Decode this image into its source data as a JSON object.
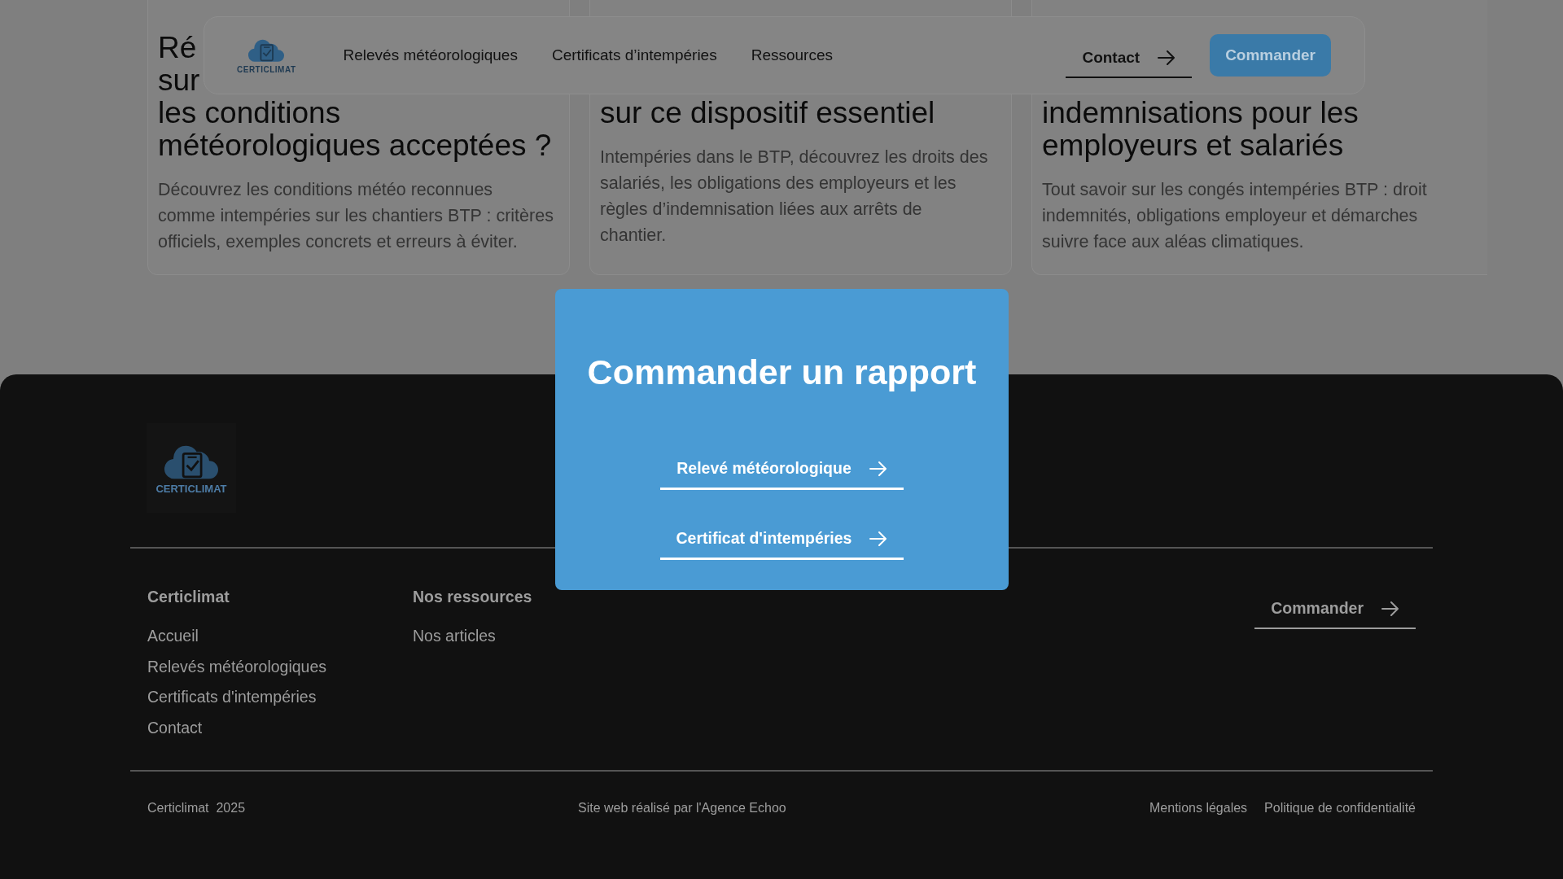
{
  "header": {
    "logo_text": "CERTICLIMAT",
    "nav": [
      "Relevés météorologiques",
      "Certificats d’intempéries",
      "Ressources"
    ],
    "contact": "Contact",
    "order_button": "Commander"
  },
  "articles": [
    {
      "title_lines": [
        "Ré",
        "sur",
        "les conditions",
        "météorologiques acceptées ?"
      ],
      "description_lines": [
        "Découvrez les conditions météo reconnues",
        "comme intempéries sur les chantiers BTP : critères",
        "officiels, exemples concrets et erreurs à éviter."
      ]
    },
    {
      "title_lines": [
        "sur ce dispositif essentiel"
      ],
      "description_lines": [
        "Intempéries dans le BTP, découvrez les droits des",
        "salariés, les obligations des employeurs et les",
        "règles d’indemnisation liées aux arrêts de",
        "chantier."
      ]
    },
    {
      "title_lines": [
        "indemnisations pour les",
        "employeurs et salariés"
      ],
      "description_lines": [
        "Tout savoir sur les congés intempéries BTP : droit",
        "indemnités, obligations employeur et démarches",
        "suivre face aux aléas climatiques."
      ]
    }
  ],
  "modal": {
    "title": "Commander un rapport",
    "links": [
      "Relevé météorologique",
      "Certificat d'intempéries"
    ]
  },
  "footer": {
    "logo_text": "CERTICLIMAT",
    "columns": [
      {
        "heading": "Certiclimat",
        "links": [
          "Accueil",
          "Relevés météorologiques",
          "Certificats d'intempéries",
          "Contact"
        ]
      },
      {
        "heading": "Nos ressources",
        "links": [
          "Nos articles"
        ]
      }
    ],
    "order_link": "Commander",
    "copyright": "Certiclimat  2025",
    "credit": "Site web réalisé par l'Agence Echoo",
    "legal_links": [
      "Mentions légales",
      "Politique de confidentialité"
    ]
  }
}
